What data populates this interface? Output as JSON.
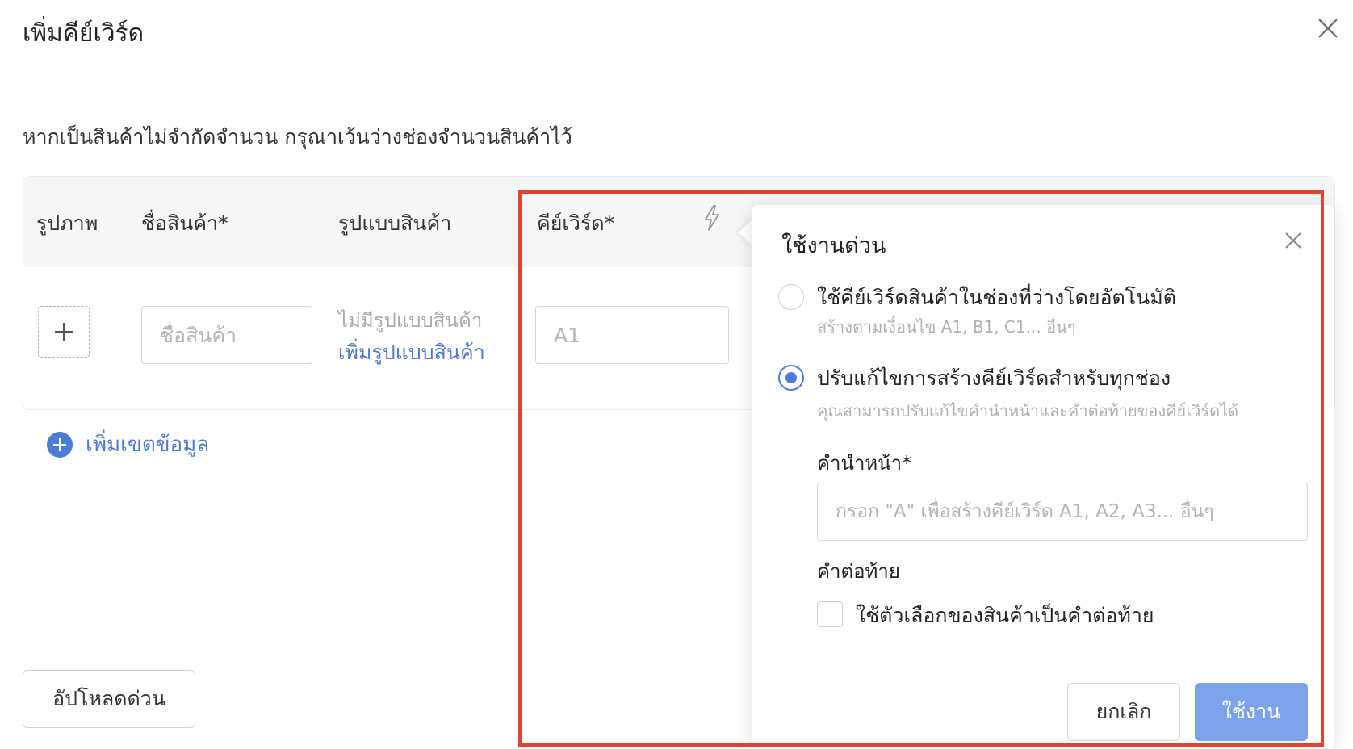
{
  "modal": {
    "title": "เพิ่มคีย์เวิร์ด",
    "notice": "หากเป็นสินค้าไม่จำกัดจำนวน กรุณาเว้นว่างช่องจำนวนสินค้าไว้"
  },
  "table": {
    "headers": {
      "image": "รูปภาพ",
      "product_name": "ชื่อสินค้า*",
      "variant": "รูปแบบสินค้า",
      "keyword": "คีย์เวิร์ด*"
    },
    "row": {
      "product_name_placeholder": "ชื่อสินค้า",
      "no_variant_text": "ไม่มีรูปแบบสินค้า",
      "add_variant_link": "เพิ่มรูปแบบสินค้า",
      "keyword_placeholder": "A1"
    }
  },
  "add_field_label": "เพิ่มเขตข้อมูล",
  "quick_upload_label": "อัปโหลดด่วน",
  "quick_use": {
    "title": "ใช้งานด่วน",
    "option_auto": {
      "label": "ใช้คีย์เวิร์ดสินค้าในช่องที่ว่างโดยอัตโนมัติ",
      "sub": "สร้างตามเงื่อนไข A1, B1, C1... อื่นๆ",
      "selected": false
    },
    "option_custom": {
      "label": "ปรับแก้ไขการสร้างคีย์เวิร์ดสำหรับทุกช่อง",
      "sub": "คุณสามารถปรับแก้ไขคำนำหน้าและคำต่อท้ายของคีย์เวิร์ดได้",
      "selected": true
    },
    "prefix_label": "คำนำหน้า*",
    "prefix_placeholder": "กรอก \"A\" เพื่อสร้างคีย์เวิร์ด A1, A2, A3... อื่นๆ",
    "suffix_label": "คำต่อท้าย",
    "suffix_checkbox_label": "ใช้ตัวเลือกของสินค้าเป็นคำต่อท้าย",
    "suffix_checked": false,
    "cancel_label": "ยกเลิก",
    "apply_label": "ใช้งาน"
  },
  "colors": {
    "accent": "#4a7bd6",
    "apply_button": "#7aa3ea",
    "highlight_border": "#e0432f",
    "table_header_bg": "#f5f6f8"
  },
  "icons": [
    "close-icon",
    "lightning-icon",
    "plus-icon",
    "plus-circle-icon"
  ]
}
